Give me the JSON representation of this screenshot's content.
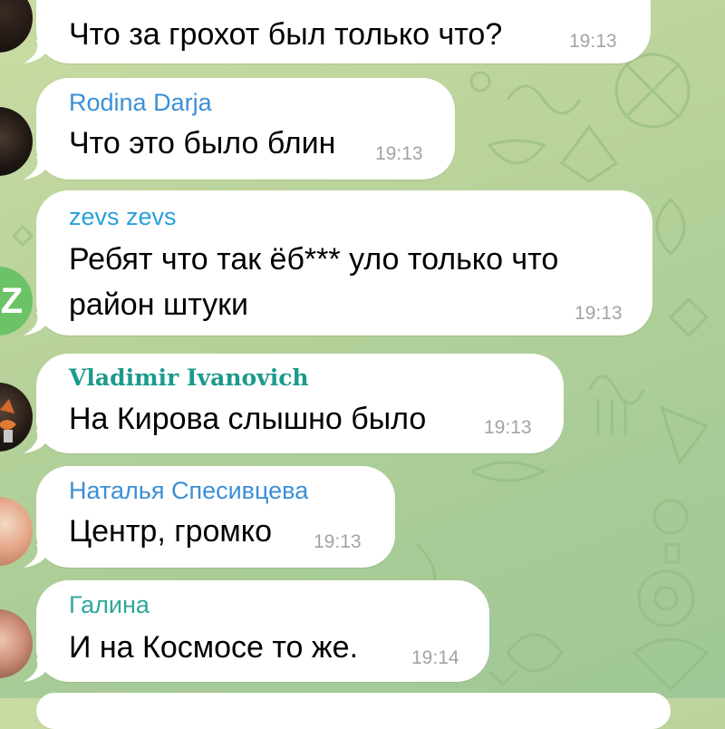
{
  "chat": {
    "messages": [
      {
        "sender": "",
        "text": "Что за грохот был только что?",
        "time": "19:13",
        "sender_color": "#3b8fd6"
      },
      {
        "sender": "Rodina Darja",
        "text": "Что это было блин",
        "time": "19:13",
        "sender_color": "#3b8fd6"
      },
      {
        "sender": "zevs zevs",
        "text_line1": "Ребят что так ёб*** уло только что",
        "text_line2": "район штуки",
        "time": "19:13",
        "sender_color": "#2a9fd8"
      },
      {
        "sender": "Vladimir Ivanovich",
        "text": "На Кирова слышно было",
        "time": "19:13",
        "sender_color": "#1a9a8a"
      },
      {
        "sender": "Наталья Спесивцева",
        "text": "Центр, громко",
        "time": "19:13",
        "sender_color": "#3b8fd6"
      },
      {
        "sender": "Галина",
        "text": "И на Космосе то же.",
        "time": "19:14",
        "sender_color": "#2fa89a"
      }
    ],
    "avatars": {
      "zevs_letter": "Z",
      "zevs_color": "#6cc267"
    }
  }
}
